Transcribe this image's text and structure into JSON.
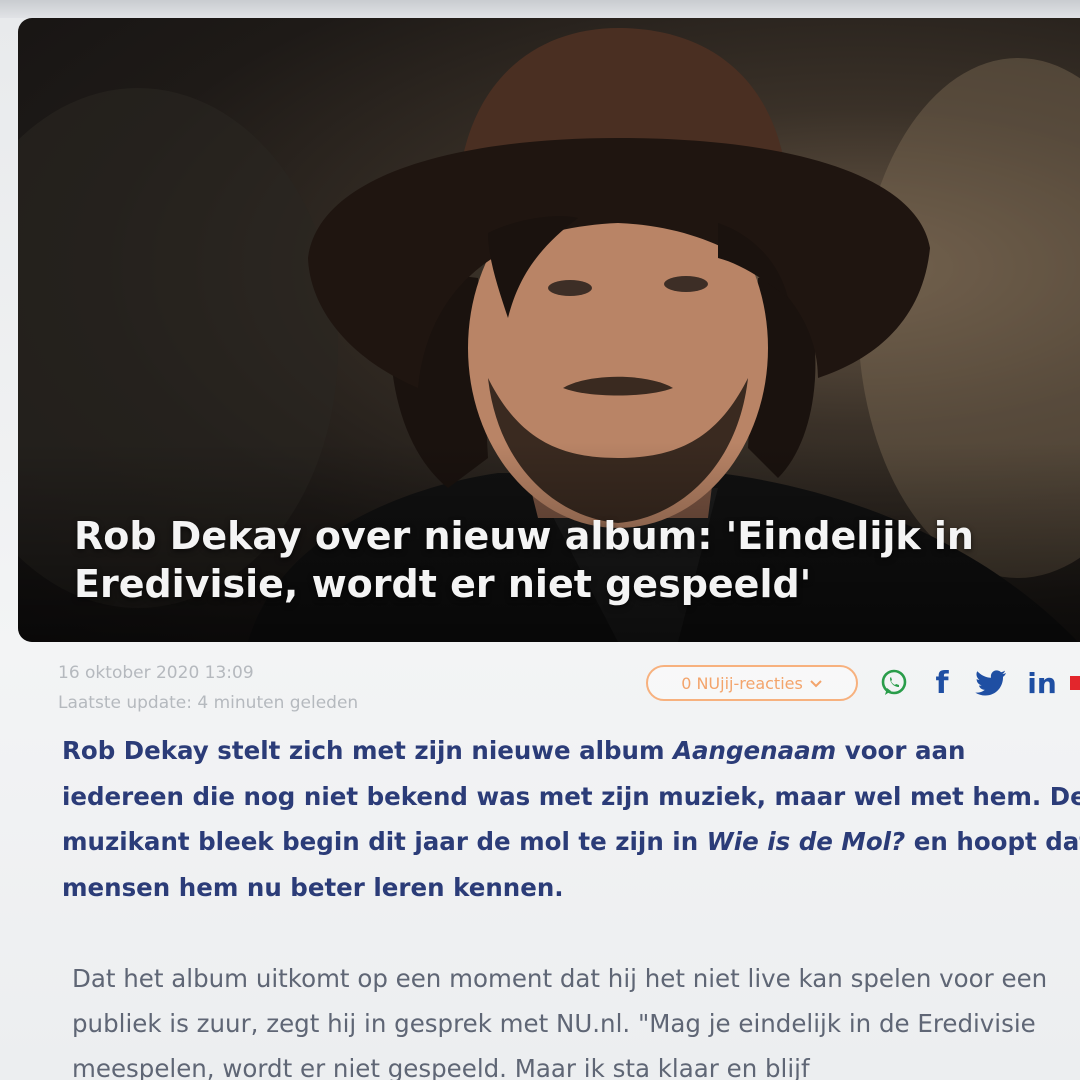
{
  "article": {
    "headline": "Rob Dekay over nieuw album: 'Eindelijk in Eredivisie, wordt er niet gespeeld'",
    "date": "16 oktober 2020 13:09",
    "last_update": "Laatste update: 4 minuten geleden",
    "reactions_label": "0 NUjij-reacties",
    "lead": {
      "part1": "Rob Dekay stelt zich met zijn nieuwe album ",
      "album": "Aangenaam",
      "part2": " voor aan iedereen die nog niet bekend was met zijn muziek, maar wel met hem. De muzikant bleek begin dit jaar de mol te zijn in ",
      "show": "Wie is de Mol?",
      "part3": " en hoopt dat mensen hem nu beter leren kennen."
    },
    "body": "Dat het album uitkomt op een moment dat hij het niet live kan spelen voor een publiek is zuur, zegt hij in gesprek met NU.nl. \"Mag je eindelijk in de Eredivisie meespelen, wordt er niet gespeeld. Maar ik sta klaar en blijf"
  },
  "share": {
    "whatsapp_icon": "whatsapp-icon",
    "facebook_glyph": "f",
    "twitter_icon": "twitter-icon",
    "linkedin_glyph": "in"
  },
  "colors": {
    "lead_text": "#2b3c78",
    "share_blue": "#1f4fa3",
    "whatsapp_green": "#2a9d4a",
    "reactions_orange": "#f3a46b"
  }
}
